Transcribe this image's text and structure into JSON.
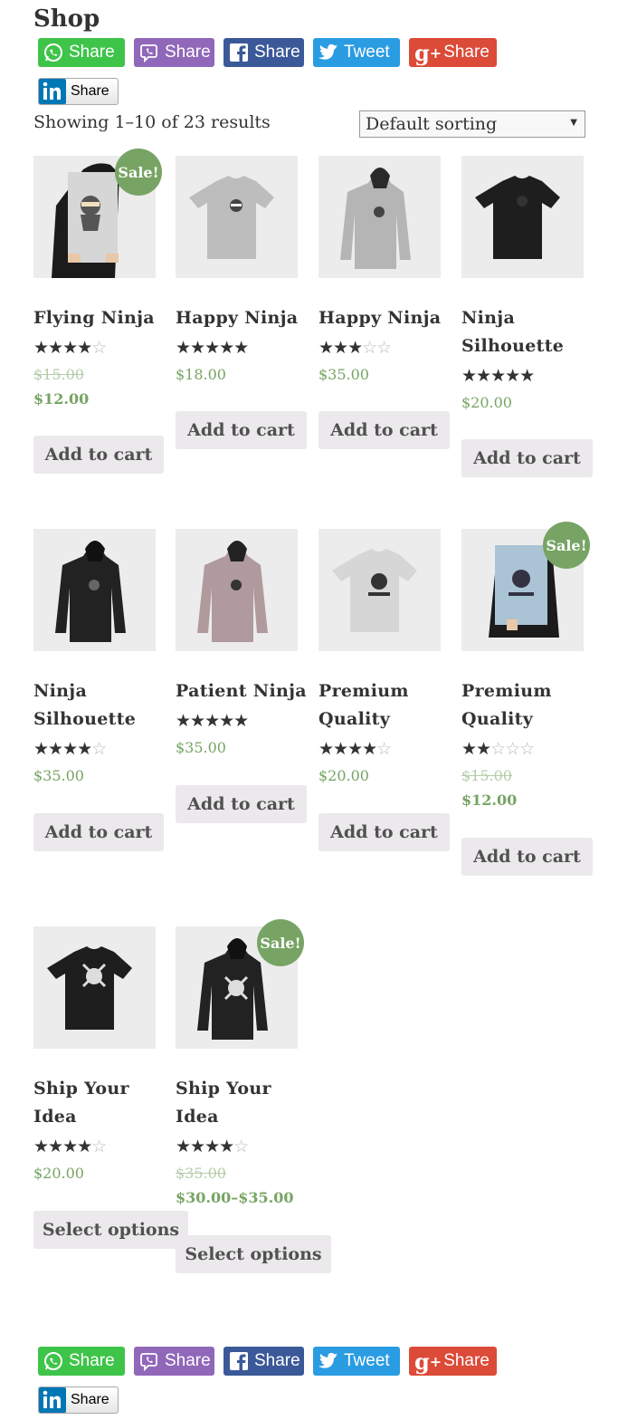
{
  "page": {
    "title": "Shop"
  },
  "share_bar": {
    "whatsapp": "Share",
    "viber": "Share",
    "facebook": "Share",
    "twitter": "Tweet",
    "googleplus": "Share",
    "linkedin": "Share"
  },
  "results_count": "Showing 1–10 of 23 results",
  "sorting": {
    "selected": "Default sorting"
  },
  "products": [
    {
      "name": "Flying Ninja",
      "rating": 4,
      "price_old": "$15.00",
      "price": "$12.00",
      "sale_badge": "Sale!",
      "button": "Add to cart",
      "image": "poster-ninja-icon"
    },
    {
      "name": "Happy Ninja",
      "rating": 5,
      "price": "$18.00",
      "button": "Add to cart",
      "image": "grey-tshirt-icon"
    },
    {
      "name": "Happy Ninja",
      "rating": 3,
      "price": "$35.00",
      "button": "Add to cart",
      "image": "grey-hoodie-icon"
    },
    {
      "name": "Ninja Silhouette",
      "rating": 5,
      "price": "$20.00",
      "button": "Add to cart",
      "image": "black-tshirt-icon"
    },
    {
      "name": "Ninja Silhouette",
      "rating": 4,
      "price": "$35.00",
      "button": "Add to cart",
      "image": "black-hoodie-icon"
    },
    {
      "name": "Patient Ninja",
      "rating": 4.7,
      "price": "$35.00",
      "button": "Add to cart",
      "image": "pink-hoodie-icon"
    },
    {
      "name": "Premium Quality",
      "rating": 4.5,
      "price": "$20.00",
      "button": "Add to cart",
      "image": "white-tshirt-icon"
    },
    {
      "name": "Premium Quality",
      "rating": 2,
      "price_old": "$15.00",
      "price": "$12.00",
      "sale_badge": "Sale!",
      "button": "Add to cart",
      "image": "poster-premium-icon"
    },
    {
      "name": "Ship Your Idea",
      "rating": 4.5,
      "price": "$20.00",
      "button": "Select options",
      "image": "black-tshirt-skull-icon"
    },
    {
      "name": "Ship Your Idea",
      "rating": 4,
      "price_old": "$35.00",
      "price": "$30.00–$35.00",
      "sale_badge": "Sale!",
      "button": "Select options",
      "image": "black-hoodie-skull-icon"
    }
  ],
  "colors": {
    "accent_green": "#77a464",
    "button_bg": "#ebe9eb",
    "text": "#333333"
  }
}
